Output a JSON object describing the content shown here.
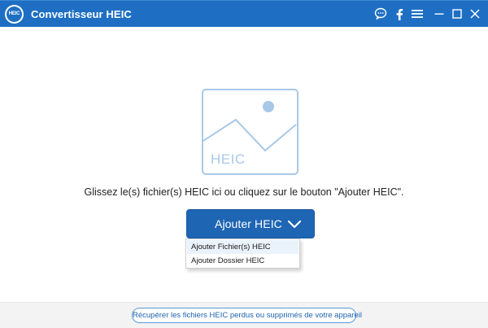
{
  "app": {
    "title": "Convertisseur HEIC",
    "logo_text": "HEIC",
    "accent_color": "#1e6fc4"
  },
  "titlebar_icons": [
    "chat-icon",
    "facebook-icon",
    "menu-icon",
    "minimize-icon",
    "maximize-icon",
    "close-icon"
  ],
  "drop_zone": {
    "image_label": "HEIC",
    "instruction": "Glissez le(s) fichier(s) HEIC ici ou cliquez sur le bouton \"Ajouter HEIC\"."
  },
  "add_button": {
    "label": "Ajouter HEIC",
    "menu": {
      "items": [
        {
          "label": "Ajouter Fichier(s) HEIC"
        },
        {
          "label": "Ajouter Dossier HEIC"
        }
      ]
    }
  },
  "footer": {
    "recover_link": "Récupérer les fichiers HEIC perdus ou supprimés de votre appareil"
  }
}
